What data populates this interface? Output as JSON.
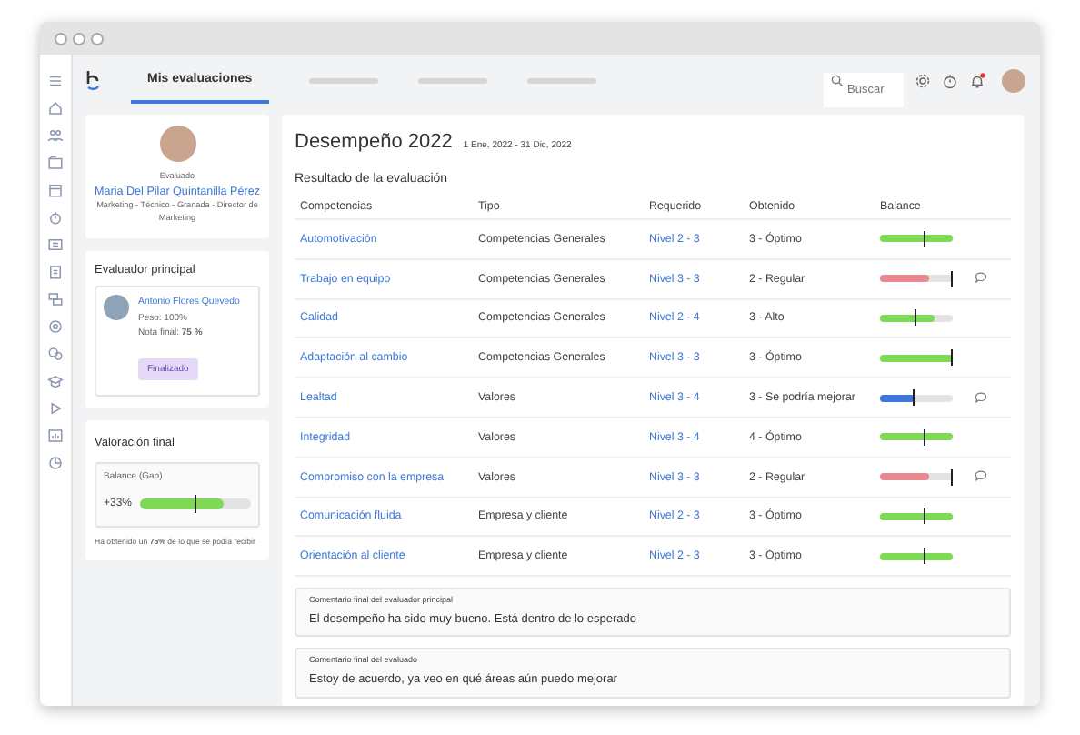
{
  "nav": {
    "tabs": [
      {
        "label": "Mis evaluaciones",
        "selected": true
      }
    ],
    "search": {
      "placeholder": "Buscar"
    },
    "notifications": {
      "unread": true
    }
  },
  "profile": {
    "role_label": "Evaluado",
    "name": "Maria Del Pilar Quintanilla Pérez",
    "details": "Marketing - Técnico - Granada - Director de Marketing"
  },
  "evaluator": {
    "title": "Evaluador principal",
    "name": "Antonio Flores Quevedo",
    "weight": "Peso: 100%",
    "grade": "Nota final: **75 %**",
    "status": "Finalizado"
  },
  "final_rating": {
    "title": "Valoración final",
    "label": "Balance (Gap)",
    "value": "+33%",
    "level": 0.75,
    "target": {
      "level": 0.5
    },
    "note": "Ha obtenido un **75%** de lo que se podía recibir"
  },
  "evaluation": {
    "title": "Desempeño 2022",
    "period": "1 Ene, 2022 - 31 Dic, 2022",
    "subtitle": "Resultado de la evaluación",
    "columns": [
      "Competencias",
      "Tipo",
      "Requerido",
      "Obtenido",
      "Balance"
    ],
    "rows": [
      {
        "competency": "Automotivación",
        "type": "Competencias Generales",
        "required": "Nivel 2 - 3",
        "obtained": "3 - Óptimo",
        "balance": {
          "level": 1,
          "color": "#7ed957",
          "target": {
            "level": 0.62
          }
        },
        "comment": false
      },
      {
        "competency": "Trabajo en equipo",
        "type": "Competencias Generales",
        "required": "Nivel 3 - 3",
        "obtained": "2 - Regular",
        "balance": {
          "level": 0.68,
          "color": "#e8878e",
          "target": {
            "level": 1
          }
        },
        "comment": true
      },
      {
        "competency": "Calidad",
        "type": "Competencias Generales",
        "required": "Nivel 2 - 4",
        "obtained": "3 - Alto",
        "balance": {
          "level": 0.75,
          "color": "#7ed957",
          "target": {
            "level": 0.5
          }
        },
        "comment": false
      },
      {
        "competency": "Adaptación al cambio",
        "type": "Competencias Generales",
        "required": "Nivel 3 - 3",
        "obtained": "3 - Óptimo",
        "balance": {
          "level": 1,
          "color": "#7ed957",
          "target": {
            "level": 1
          }
        },
        "comment": false
      },
      {
        "competency": "Lealtad",
        "type": "Valores",
        "required": "Nivel 3 - 4",
        "obtained": "3 - Se podría mejorar",
        "balance": {
          "level": 0.48,
          "color": "#3b78d8",
          "target": {
            "level": 0.48
          }
        },
        "comment": true
      },
      {
        "competency": "Integridad",
        "type": "Valores",
        "required": "Nivel 3 - 4",
        "obtained": "4 - Óptimo",
        "balance": {
          "level": 1,
          "color": "#7ed957",
          "target": {
            "level": 0.62
          }
        },
        "comment": false
      },
      {
        "competency": "Compromiso con la empresa",
        "type": "Valores",
        "required": "Nivel 3 - 3",
        "obtained": "2 - Regular",
        "balance": {
          "level": 0.68,
          "color": "#e8878e",
          "target": {
            "level": 1
          }
        },
        "comment": true
      },
      {
        "competency": "Comunicación fluida",
        "type": "Empresa y cliente",
        "required": "Nivel 2 - 3",
        "obtained": "3 - Óptimo",
        "balance": {
          "level": 1,
          "color": "#7ed957",
          "target": {
            "level": 0.62
          }
        },
        "comment": false
      },
      {
        "competency": "Orientación al cliente",
        "type": "Empresa y cliente",
        "required": "Nivel 2 - 3",
        "obtained": "3 - Óptimo",
        "balance": {
          "level": 1,
          "color": "#7ed957",
          "target": {
            "level": 0.62
          }
        },
        "comment": false
      }
    ],
    "comments": [
      {
        "label": "Comentario final del evaluador principal",
        "text": "El desempeño ha sido muy bueno. Está dentro de lo esperado"
      },
      {
        "label": "Comentario final del evaluado",
        "text": "Estoy de acuerdo, ya veo en qué áreas aún puedo mejorar"
      }
    ]
  }
}
